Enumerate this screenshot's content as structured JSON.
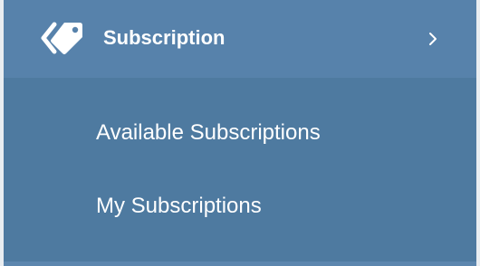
{
  "menu": {
    "header": {
      "label": "Subscription",
      "icon": "tags-icon",
      "expand_icon": "chevron-right-icon"
    },
    "items": [
      {
        "label": "Available Subscriptions"
      },
      {
        "label": "My Subscriptions"
      }
    ]
  },
  "colors": {
    "header_background": "#5782ab",
    "submenu_background": "#4e7aa0",
    "text": "#ffffff"
  }
}
